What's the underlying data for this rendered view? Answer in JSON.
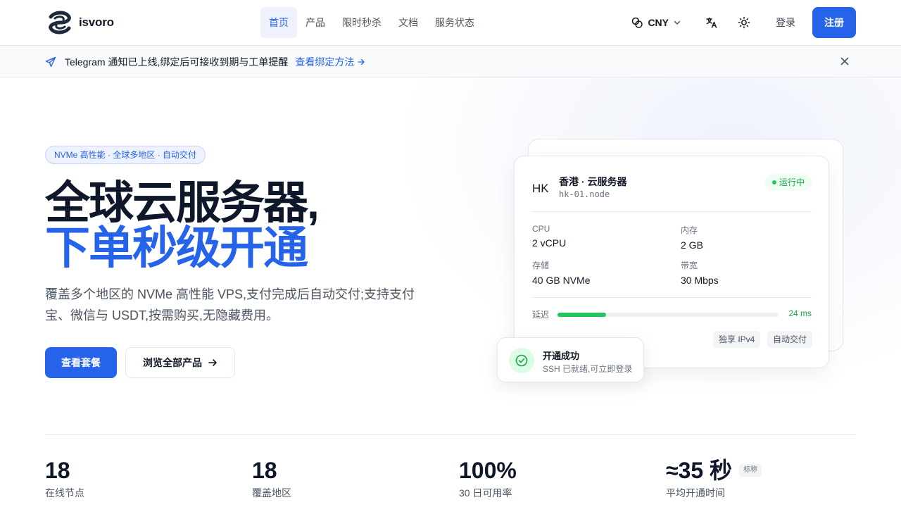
{
  "brand": {
    "name": "isvoro"
  },
  "nav": {
    "items": [
      {
        "label": "首页",
        "active": true
      },
      {
        "label": "产品"
      },
      {
        "label": "限时秒杀"
      },
      {
        "label": "文档"
      },
      {
        "label": "服务状态"
      }
    ]
  },
  "header": {
    "currency": "CNY",
    "login_label": "登录",
    "register_label": "注册"
  },
  "notice": {
    "text": "Telegram 通知已上线,绑定后可接收到期与工单提醒",
    "link_label": "查看绑定方法"
  },
  "hero": {
    "badge": "NVMe 高性能 · 全球多地区 · 自动交付",
    "title_line1": "全球云服务器,",
    "title_line2": "下单秒级开通",
    "description": "覆盖多个地区的 NVMe 高性能 VPS,支付完成后自动交付;支持支付宝、微信与 USDT,按需购买,无隐藏费用。",
    "primary_button": "查看套餐",
    "secondary_button": "浏览全部产品"
  },
  "server_card": {
    "region_code": "HK",
    "name": "香港 · 云服务器",
    "node": "hk-01.node",
    "status": "运行中",
    "specs": [
      {
        "label": "CPU",
        "value": "2 vCPU"
      },
      {
        "label": "内存",
        "value": "2 GB"
      },
      {
        "label": "存储",
        "value": "40 GB NVMe"
      },
      {
        "label": "带宽",
        "value": "30 Mbps"
      }
    ],
    "latency_label": "延迟",
    "latency_value": "24 ms",
    "latency_fraction": 0.22,
    "tags": [
      "独享 IPv4",
      "自动交付"
    ]
  },
  "toast": {
    "title": "开通成功",
    "subtitle": "SSH 已就绪,可立即登录"
  },
  "stats": [
    {
      "value": "18",
      "label": "在线节点"
    },
    {
      "value": "18",
      "label": "覆盖地区"
    },
    {
      "value": "100%",
      "label": "30 日可用率"
    },
    {
      "value": "≈35 秒",
      "label": "平均开通时间",
      "tag": "标称"
    }
  ],
  "colors": {
    "accent": "#2563eb",
    "success": "#22c55e",
    "text": "#0f172a"
  },
  "icons": {
    "logo": "isvoro-logo-icon",
    "currency": "coins-icon",
    "language": "translate-icon",
    "theme": "sun-icon",
    "notice": "send-icon",
    "close": "close-icon"
  }
}
